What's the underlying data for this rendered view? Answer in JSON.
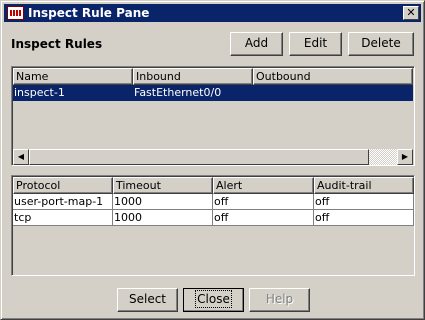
{
  "window": {
    "title": "Inspect Rule Pane",
    "close_glyph": "✕",
    "app_icon": "router-icon"
  },
  "section_title": "Inspect Rules",
  "toolbar": {
    "add_label": "Add",
    "edit_label": "Edit",
    "delete_label": "Delete"
  },
  "rules_table": {
    "columns": [
      "Name",
      "Inbound",
      "Outbound"
    ],
    "rows": [
      {
        "name": "inspect-1",
        "inbound": "FastEthernet0/0",
        "outbound": ""
      }
    ]
  },
  "scrollbar": {
    "left_arrow": "◀",
    "right_arrow": "▶"
  },
  "protocol_table": {
    "columns": [
      "Protocol",
      "Timeout",
      "Alert",
      "Audit-trail"
    ],
    "rows": [
      {
        "protocol": "user-port-map-1",
        "timeout": "1000",
        "alert": "off",
        "audit": "off"
      },
      {
        "protocol": "tcp",
        "timeout": "1000",
        "alert": "off",
        "audit": "off"
      }
    ]
  },
  "footer": {
    "select_label": "Select",
    "close_label": "Close",
    "help_label": "Help"
  },
  "colors": {
    "titlebar": "#0a246a",
    "selection": "#0a246a",
    "face": "#d4d0c8"
  }
}
